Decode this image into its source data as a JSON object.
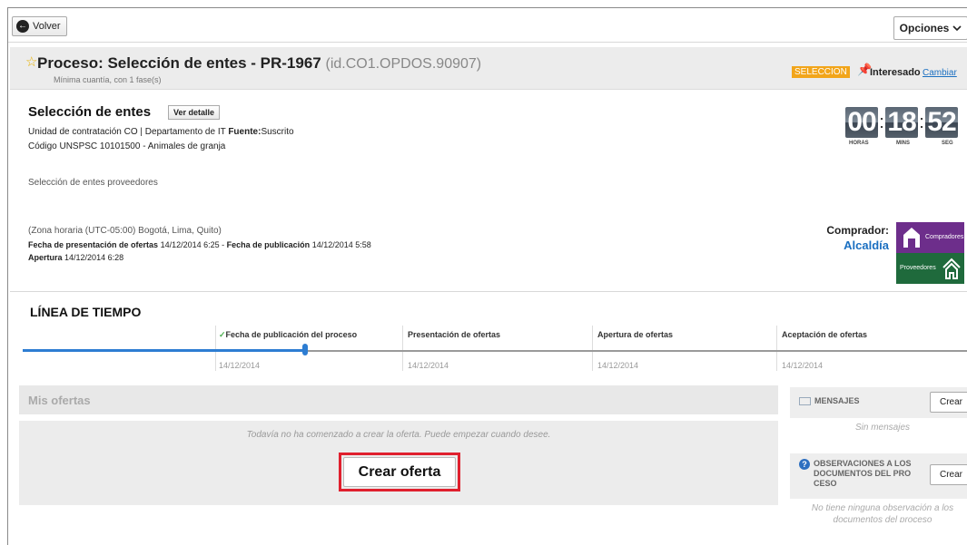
{
  "topbar": {
    "back_label": "Volver",
    "options_label": "Opciones"
  },
  "header": {
    "title": "Proceso: Selección de entes - PR-1967",
    "process_id": "(id.CO1.OPDOS.90907)",
    "subtitle": "Mínima cuantía, con 1 fase(s)",
    "status_badge": "SELECCION",
    "interest_label": "Interesado",
    "change_link": "Cambiar"
  },
  "info": {
    "title": "Selección de entes",
    "detail_button": "Ver detalle",
    "unit_line": "Unidad de contratación CO | Departamento de IT",
    "source_label": "Fuente:",
    "source_value": "Suscrito",
    "unspsc": "Código UNSPSC 10101500 - Animales de granja",
    "description": "Selección de entes proveedores",
    "timezone": "(Zona horaria (UTC-05:00) Bogotá, Lima, Quito)",
    "offers_label": "Fecha de presentación de ofertas",
    "offers_date": "14/12/2014 6:25",
    "pub_label": "Fecha de publicación",
    "pub_date": "14/12/2014 5:58",
    "opening_label": "Apertura",
    "opening_date": "14/12/2014 6:28",
    "buyer_label": "Comprador:",
    "buyer_name": "Alcaldía"
  },
  "timer": {
    "hours": "00",
    "mins": "18",
    "secs": "52",
    "hours_label": "HORAS",
    "mins_label": "MINS",
    "secs_label": "SEG"
  },
  "logo": {
    "top_text": "Compradores",
    "bottom_text": "Proveedores"
  },
  "timeline": {
    "title": "LÍNEA DE TIEMPO",
    "progress_percent": 30,
    "stages": [
      {
        "label": "Fecha de publicación del proceso",
        "date": "14/12/2014",
        "check": "✓"
      },
      {
        "label": "Presentación de ofertas",
        "date": "14/12/2014"
      },
      {
        "label": "Apertura de ofertas",
        "date": "14/12/2014"
      },
      {
        "label": "Aceptación de ofertas",
        "date": "14/12/2014"
      }
    ]
  },
  "offers": {
    "title": "Mis ofertas",
    "empty_message": "Todavía no ha comenzado a crear la oferta. Puede empezar cuando desee.",
    "create_button": "Crear oferta"
  },
  "messages": {
    "title": "MENSAJES",
    "create_button": "Crear",
    "empty": "Sin mensajes"
  },
  "observations": {
    "title": "OBSERVACIONES A LOS DOCUMENTOS DEL PRO CESO",
    "create_button": "Crear",
    "empty": "No tiene ninguna observación a los documentos del proceso"
  },
  "colors": {
    "accent": "#1a6fc1",
    "badge": "#f2a51a",
    "highlight": "#e0202e"
  }
}
